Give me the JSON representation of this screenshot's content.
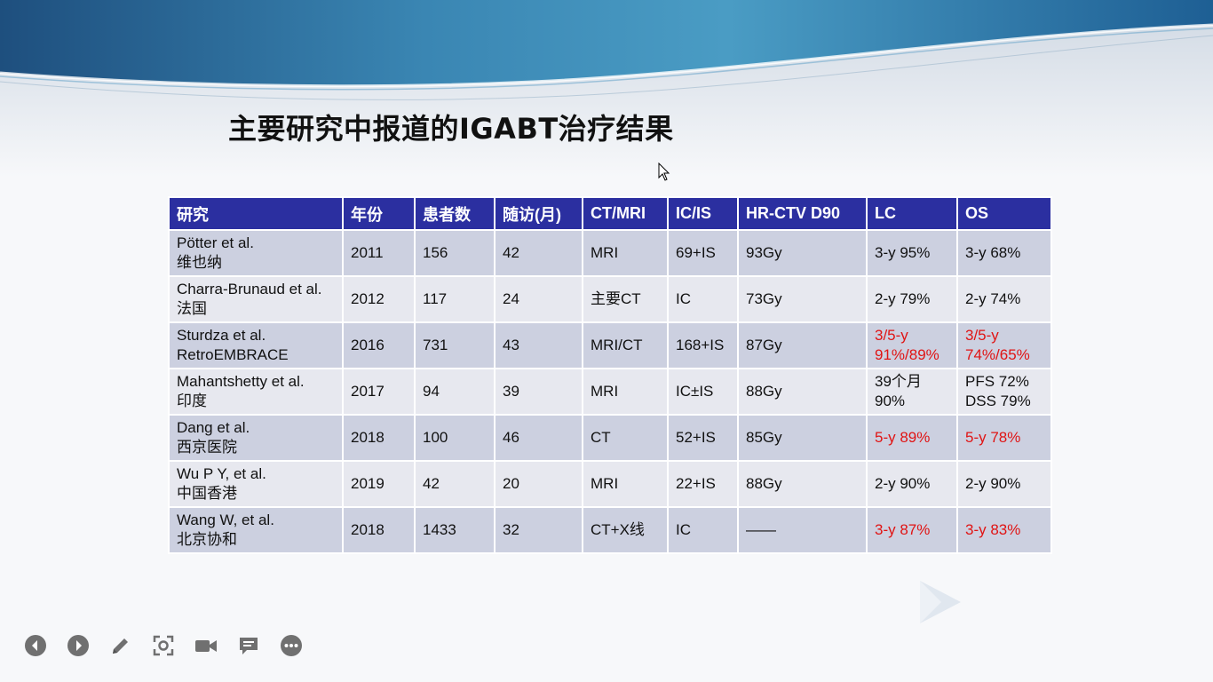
{
  "slide": {
    "title": "主要研究中报道的IGABT治疗结果"
  },
  "table": {
    "headers": [
      "研究",
      "年份",
      "患者数",
      "随访(月)",
      "CT/MRI",
      "IC/IS",
      "HR-CTV D90",
      "LC",
      "OS"
    ],
    "rows": [
      {
        "study": "Pötter et al.",
        "study_sub": "维也纳",
        "year": "2011",
        "patients": "156",
        "followup": "42",
        "imaging": "MRI",
        "icis": "69+IS",
        "d90": "93Gy",
        "lc": "3-y  95%",
        "lc_sub": "",
        "lc_red": false,
        "os": "3-y  68%",
        "os_sub": "",
        "os_red": false
      },
      {
        "study": "Charra-Brunaud et al.",
        "study_sub": "法国",
        "year": "2012",
        "patients": "117",
        "followup": "24",
        "imaging": "主要CT",
        "icis": "IC",
        "d90": "73Gy",
        "lc": "2-y  79%",
        "lc_sub": "",
        "lc_red": false,
        "os": "2-y  74%",
        "os_sub": "",
        "os_red": false
      },
      {
        "study": "Sturdza et al.",
        "study_sub": "RetroEMBRACE",
        "year": "2016",
        "patients": "731",
        "followup": "43",
        "imaging": "MRI/CT",
        "icis": "168+IS",
        "d90": "87Gy",
        "lc": "3/5-y",
        "lc_sub": "91%/89%",
        "lc_red": true,
        "os": "3/5-y",
        "os_sub": "74%/65%",
        "os_red": true
      },
      {
        "study": "Mahantshetty et al.",
        "study_sub": "印度",
        "year": "2017",
        "patients": "94",
        "followup": "39",
        "imaging": "MRI",
        "icis": "IC±IS",
        "d90": "88Gy",
        "lc": "39个月",
        "lc_sub": "90%",
        "lc_red": false,
        "os": "PFS  72%",
        "os_sub": "DSS 79%",
        "os_red": false
      },
      {
        "study": "Dang et al.",
        "study_sub": "西京医院",
        "year": "2018",
        "patients": "100",
        "followup": "46",
        "imaging": "CT",
        "icis": "52+IS",
        "d90": "85Gy",
        "lc": "5-y 89%",
        "lc_sub": "",
        "lc_red": true,
        "os": "5-y 78%",
        "os_sub": "",
        "os_red": true
      },
      {
        "study": "Wu P Y, et al.",
        "study_sub": "中国香港",
        "year": "2019",
        "patients": "42",
        "followup": "20",
        "imaging": "MRI",
        "icis": "22+IS",
        "d90": "88Gy",
        "lc": "2-y  90%",
        "lc_sub": "",
        "lc_red": false,
        "os": "2-y  90%",
        "os_sub": "",
        "os_red": false
      },
      {
        "study": "Wang W, et al.",
        "study_sub": "北京协和",
        "year": "2018",
        "patients": "1433",
        "followup": "32",
        "imaging": "CT+X线",
        "icis": "IC",
        "d90": "——",
        "lc": "3-y  87%",
        "lc_sub": "",
        "lc_red": true,
        "os": "3-y  83%",
        "os_sub": "",
        "os_red": true
      }
    ]
  },
  "colors": {
    "header_bg": "#2b2fa0",
    "row_odd": "#ccd0e0",
    "row_even": "#e7e8ef",
    "highlight": "#e01414",
    "banner": "#3f8fb8"
  },
  "controls": [
    {
      "name": "previous-slide-button",
      "icon": "chevron-left-circle"
    },
    {
      "name": "next-slide-button",
      "icon": "chevron-right-circle"
    },
    {
      "name": "pen-tool-button",
      "icon": "pencil"
    },
    {
      "name": "zoom-button",
      "icon": "target-frame"
    },
    {
      "name": "camera-button",
      "icon": "video-camera"
    },
    {
      "name": "subtitle-button",
      "icon": "speech-bubble"
    },
    {
      "name": "more-options-button",
      "icon": "ellipsis"
    }
  ]
}
